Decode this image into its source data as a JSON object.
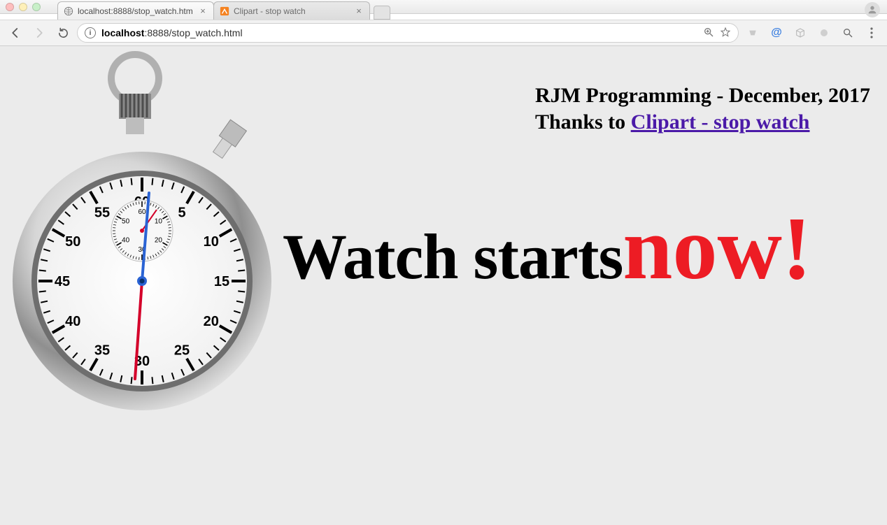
{
  "window": {
    "traffic": {
      "close": "close",
      "min": "minimize",
      "max": "zoom"
    },
    "avatar": "account"
  },
  "tabs": [
    {
      "title": "localhost:8888/stop_watch.htm",
      "active": true,
      "favicon": "globe"
    },
    {
      "title": "Clipart - stop watch",
      "active": false,
      "favicon": "oc"
    }
  ],
  "toolbar": {
    "back": "←",
    "forward": "→",
    "reload": "⟳",
    "zoom": "⊕",
    "star": "☆",
    "menu": "⋮",
    "search": "search"
  },
  "omnibox": {
    "host_bold": "localhost",
    "rest": ":8888/stop_watch.html"
  },
  "credit": {
    "line1": "RJM Programming - December, 2017",
    "thanks_prefix": "Thanks to ",
    "link_text": "Clipart - stop watch"
  },
  "headline": {
    "black": "Watch starts",
    "red": "now!"
  },
  "dial": {
    "main_numbers": [
      "60",
      "5",
      "10",
      "15",
      "20",
      "25",
      "30",
      "35",
      "40",
      "45",
      "50",
      "55"
    ],
    "small_numbers": [
      "60",
      "10",
      "20",
      "30",
      "40",
      "50"
    ]
  }
}
